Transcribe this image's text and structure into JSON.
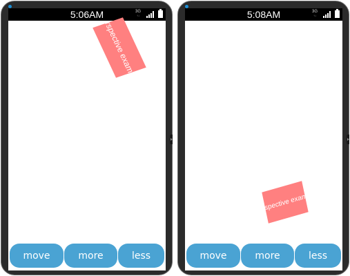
{
  "colors": {
    "accent": "#4aa3d3",
    "card": "#ff8080",
    "status_bar": "#000000"
  },
  "screens": [
    {
      "status": {
        "time": "5:06AM",
        "network": "3G",
        "network_sub": "↑↓"
      },
      "card_text": "Perspective example",
      "buttons": {
        "move": "move",
        "more": "more",
        "less": "less"
      }
    },
    {
      "status": {
        "time": "5:08AM",
        "network": "3G",
        "network_sub": "↑↓"
      },
      "card_text": "Perspective example",
      "buttons": {
        "move": "move",
        "more": "more",
        "less": "less"
      }
    }
  ]
}
